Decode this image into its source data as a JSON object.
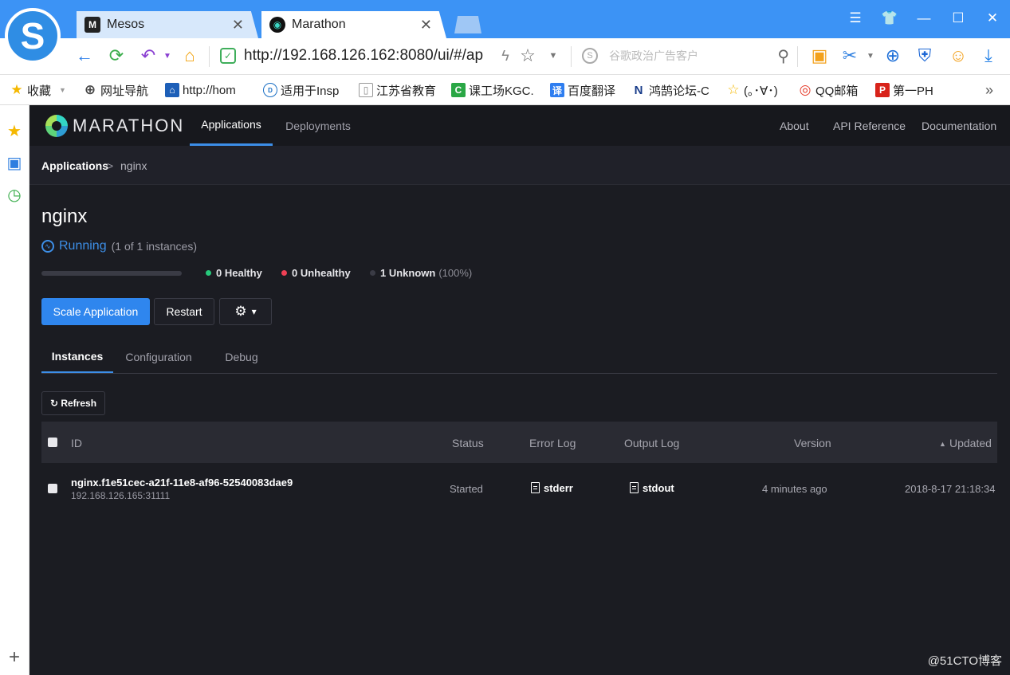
{
  "browser": {
    "tabs": [
      {
        "label": "Mesos",
        "favicon": "M",
        "active": false
      },
      {
        "label": "Marathon",
        "favicon": "◉",
        "active": true
      }
    ],
    "window_controls": [
      "menu-icon",
      "skin-icon",
      "minimize-icon",
      "maximize-icon",
      "close-icon"
    ],
    "address": {
      "url": "http://192.168.126.162:8080/ui/#/ap"
    },
    "search": {
      "placeholder": "谷歌政治广告客户"
    },
    "bookmarks": [
      {
        "label": "收藏",
        "icon": "★"
      },
      {
        "label": "网址导航",
        "icon": "⊕"
      },
      {
        "label": "http://hom",
        "icon": "⌂"
      },
      {
        "label": "适用于Insp",
        "icon": "D"
      },
      {
        "label": "江苏省教育",
        "icon": "▯"
      },
      {
        "label": "课工场KGC.",
        "icon": "C"
      },
      {
        "label": "百度翻译",
        "icon": "译"
      },
      {
        "label": "鸿鹄论坛-C",
        "icon": "N"
      },
      {
        "label": "(｡･∀･)",
        "icon": "☆"
      },
      {
        "label": "QQ邮箱",
        "icon": "◎"
      },
      {
        "label": "第一PH",
        "icon": "P"
      }
    ],
    "bookmarks_more": "»"
  },
  "app": {
    "brand": "MARATHON",
    "main_tabs": [
      "Applications",
      "Deployments"
    ],
    "header_links": [
      "About",
      "API Reference",
      "Documentation"
    ],
    "breadcrumb": {
      "root": "Applications",
      "separator": ">",
      "current": "nginx"
    },
    "title": "nginx",
    "status": {
      "label": "Running",
      "count": "(1 of 1 instances)"
    },
    "health": {
      "healthy": "0 Healthy",
      "unhealthy": "0 Unhealthy",
      "unknown": "1 Unknown",
      "unknown_pct": "(100%)",
      "colors": {
        "healthy": "#27c97b",
        "unhealthy": "#ef4055",
        "unknown": "#3a3b45"
      }
    },
    "actions": {
      "scale": "Scale Application",
      "restart": "Restart",
      "settings_icon": "⚙",
      "caret": "▾"
    },
    "sub_tabs": [
      "Instances",
      "Configuration",
      "Debug"
    ],
    "refresh": "↻ Refresh",
    "table": {
      "columns": {
        "id": "ID",
        "status": "Status",
        "error_log": "Error Log",
        "output_log": "Output Log",
        "version": "Version",
        "updated": "Updated",
        "sort_arrow": "▲"
      },
      "rows": [
        {
          "id": "nginx.f1e51cec-a21f-11e8-af96-52540083dae9",
          "host": "192.168.126.165:31111",
          "status": "Started",
          "stderr": "stderr",
          "stdout": "stdout",
          "version": "4 minutes ago",
          "updated": "2018-8-17 21:18:34"
        }
      ]
    },
    "watermark": "@51CTO博客"
  }
}
